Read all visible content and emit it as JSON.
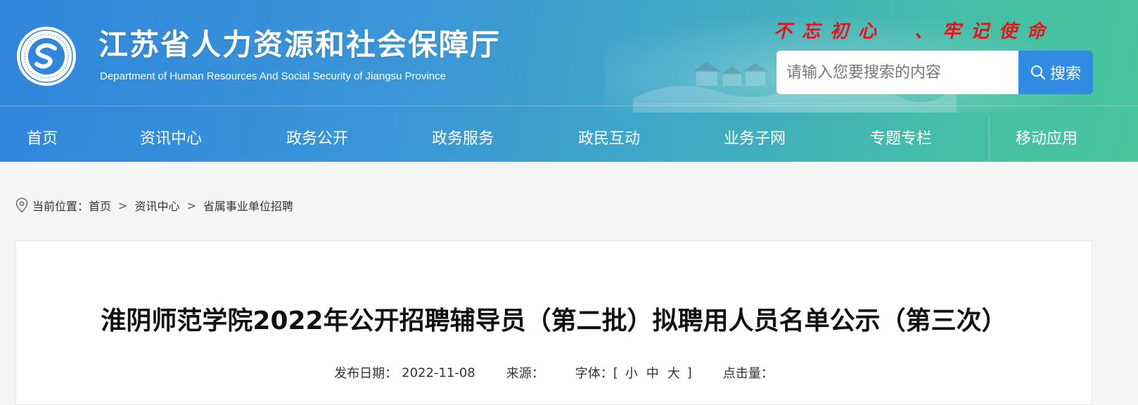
{
  "header": {
    "title": "江苏省人力资源和社会保障厅",
    "subtitle": "Department of Human Resources And Social Security of Jiangsu Province",
    "slogan": "不忘初心　、牢记使命",
    "logo_ring_text": "江苏省人力资源和社会保障厅"
  },
  "search": {
    "placeholder": "请输入您要搜索的内容",
    "button_label": "搜索",
    "icon": "search-icon"
  },
  "nav": {
    "items": [
      {
        "label": "首页"
      },
      {
        "label": "资讯中心"
      },
      {
        "label": "政务公开"
      },
      {
        "label": "政务服务"
      },
      {
        "label": "政民互动"
      },
      {
        "label": "业务子网"
      },
      {
        "label": "专题专栏"
      },
      {
        "label": "移动应用"
      }
    ]
  },
  "breadcrumb": {
    "icon": "location-pin-icon",
    "prefix": "当前位置：",
    "items": [
      "首页",
      "资讯中心",
      "省属事业单位招聘"
    ],
    "separator": ">"
  },
  "article": {
    "title": "淮阴师范学院2022年公开招聘辅导员（第二批）拟聘用人员名单公示（第三次）",
    "date_label": "发布日期：",
    "date": "2022-11-08",
    "source_label": "来源：",
    "source": "",
    "font_label": "字体：",
    "font_open": "[",
    "font_small": "小",
    "font_medium": "中",
    "font_large": "大",
    "font_close": "]",
    "clicks_label": "点击量："
  },
  "colors": {
    "header_gradient_start": "#2f86dc",
    "header_gradient_end": "#49c59c",
    "slogan": "#e8141b",
    "search_button": "#2f8ce0"
  }
}
